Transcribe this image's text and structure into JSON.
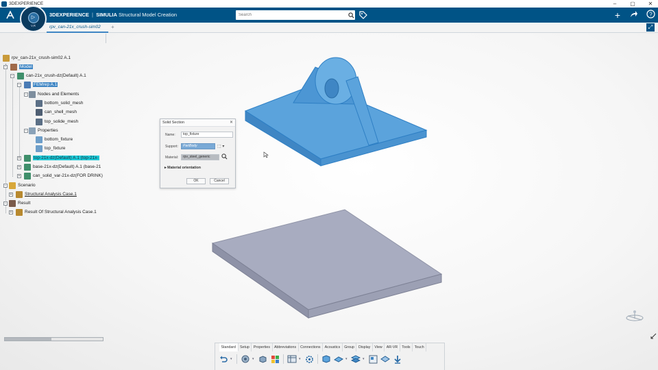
{
  "window": {
    "title": "3DEXPERIENCE",
    "controls": [
      "–",
      "▢",
      "✕"
    ]
  },
  "topbar": {
    "brand_bold": "3DEXPERIENCE",
    "brand_sep": "|",
    "brand_product": "SIMULIA",
    "brand_app": "Structural Model Creation",
    "search_placeholder": "Search",
    "compass_label": "V,R"
  },
  "tabs": [
    {
      "label": "rpv_can-21x_crush-sim02"
    }
  ],
  "tree": {
    "root": "rpv_can-21x_crush-sim02 A.1",
    "model": "Model",
    "can": "can-21x_crush-dz(Default) A.1",
    "femrep": "FEMrep A.1",
    "nodes": "Nodes and Elements",
    "mesh1": "bottom_solid_mesh",
    "mesh2": "can_shell_mesh",
    "mesh3": "top_solide_mesh",
    "properties": "Properties",
    "prop1": "bottom_fixture",
    "prop2": "top_fixture",
    "top": "top-21x-dz(Default) A.1 (top-21x-",
    "base": "base-21x-dz(Default) A.1 (base-21",
    "solid": "can_solid_var-21x-dz(FOR DRINK)",
    "scenario": "Scenario",
    "analysis": "Structural Analysis Case.1",
    "result": "Result",
    "result_of": "Result Of Structural Analysis Case.1"
  },
  "dialog": {
    "title": "Solid Section",
    "name_label": "Name:",
    "name_value": "top_fixture",
    "support_label": "Support:",
    "support_value": "PartBody",
    "material_label": "Material:",
    "material_value": "rpv_steel_generic",
    "section": "Material orientation",
    "ok": "OK",
    "cancel": "Cancel"
  },
  "action_bar": {
    "tabs": [
      "Standard",
      "Setup",
      "Properties",
      "Abbreviations",
      "Connections",
      "Acoustics",
      "Group",
      "Display",
      "View",
      "AR-VR",
      "Tools",
      "Touch"
    ]
  },
  "colors": {
    "brand": "#005386",
    "selection": "#3f86c4",
    "highlight": "#1ecbd8",
    "part_blue": "#5ba3dc",
    "plate_grey": "#a8acc0"
  }
}
